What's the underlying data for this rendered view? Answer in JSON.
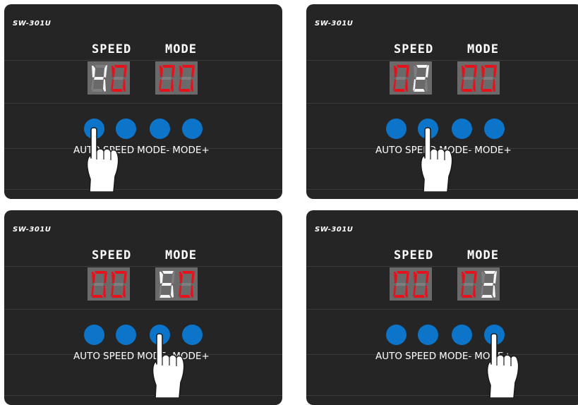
{
  "panels": [
    {
      "model": "SW-301U",
      "speed_label": "SPEED",
      "mode_label": "MODE",
      "speed_digits": [
        {
          "char": "4",
          "color": "white"
        },
        {
          "char": "0",
          "color": "red"
        }
      ],
      "mode_digits": [
        {
          "char": "0",
          "color": "red"
        },
        {
          "char": "0",
          "color": "red"
        }
      ],
      "buttons": [
        "AUTO",
        "SPEED",
        "MODE-",
        "MODE+"
      ],
      "pressed": 0
    },
    {
      "model": "SW-301U",
      "speed_label": "SPEED",
      "mode_label": "MODE",
      "speed_digits": [
        {
          "char": "0",
          "color": "red"
        },
        {
          "char": "2",
          "color": "white"
        }
      ],
      "mode_digits": [
        {
          "char": "0",
          "color": "red"
        },
        {
          "char": "0",
          "color": "red"
        }
      ],
      "buttons": [
        "AUTO",
        "SPEED",
        "MODE-",
        "MODE+"
      ],
      "pressed": 1
    },
    {
      "model": "SW-301U",
      "speed_label": "SPEED",
      "mode_label": "MODE",
      "speed_digits": [
        {
          "char": "0",
          "color": "red"
        },
        {
          "char": "0",
          "color": "red"
        }
      ],
      "mode_digits": [
        {
          "char": "5",
          "color": "white"
        },
        {
          "char": "0",
          "color": "red"
        }
      ],
      "buttons": [
        "AUTO",
        "SPEED",
        "MODE-",
        "MODE+"
      ],
      "pressed": 2
    },
    {
      "model": "SW-301U",
      "speed_label": "SPEED",
      "mode_label": "MODE",
      "speed_digits": [
        {
          "char": "0",
          "color": "red"
        },
        {
          "char": "0",
          "color": "red"
        }
      ],
      "mode_digits": [
        {
          "char": "0",
          "color": "red"
        },
        {
          "char": "3",
          "color": "white"
        }
      ],
      "buttons": [
        "AUTO",
        "SPEED",
        "MODE-",
        "MODE+"
      ],
      "pressed": 3
    }
  ],
  "colors": {
    "panel_bg": "#252525",
    "display_bg": "#6a6a6a",
    "segment_red": "#e8101a",
    "segment_white": "#f5f5f5",
    "segment_off": "#7e7e7e",
    "button_blue": "#0c74c9",
    "text": "#ffffff"
  },
  "icons": {
    "pointer": "pointing-hand-icon"
  }
}
